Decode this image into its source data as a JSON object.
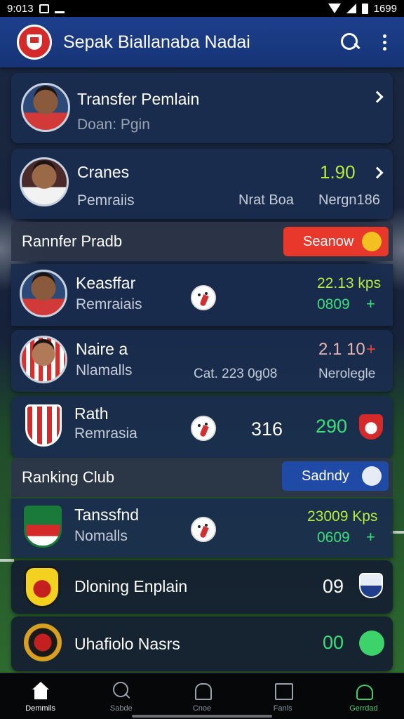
{
  "status_bar": {
    "time": "9:013",
    "clock_right": "1699"
  },
  "app_bar": {
    "title": "Sepak Biallanaba Nadai",
    "logo_icon": "club-crest-icon",
    "search_icon": "search-icon",
    "more_icon": "more-vert-icon"
  },
  "cards_top": [
    {
      "title": "Transfer Pemlain",
      "subtitle": "Doan: Pgin"
    },
    {
      "title": "Cranes",
      "subtitle": "Pemraiis",
      "meta": "Nrat Boa",
      "value": "1.90",
      "value2": "Nergn186"
    }
  ],
  "section_transfer": {
    "title": "Rannfer Pradb",
    "pill_label": "Seanow",
    "pill_color": "#e8382c"
  },
  "transfer_rows": [
    {
      "title": "Keasffar",
      "subtitle": "Remraiais",
      "value": "22.13 kps",
      "value2": "0809",
      "trend": "+"
    },
    {
      "title": "Naire a",
      "subtitle": "Nlamalls",
      "meta": "Cat. 223 0g08",
      "value": "2.1 10",
      "trend": "+",
      "value2": "Nerolegle"
    },
    {
      "title": "Rath",
      "subtitle": "Remrasia",
      "score": "316",
      "value": "290"
    }
  ],
  "section_ranking": {
    "title": "Ranking Club",
    "pill_label": "Sadndy",
    "pill_color": "#1f4aa6"
  },
  "ranking_rows": [
    {
      "title": "Tanssfnd",
      "subtitle": "Nomalls",
      "value": "23009 Kps",
      "value2": "0609",
      "trend": "+"
    },
    {
      "title": "Dloning Enplain",
      "score": "09"
    },
    {
      "title": "Uhafiolo Nasrs",
      "score": "00"
    }
  ],
  "bottom_nav": [
    {
      "label": "Demmils",
      "icon": "home-icon"
    },
    {
      "label": "Sabde",
      "icon": "search-icon"
    },
    {
      "label": "Cnoe",
      "icon": "bell-icon"
    },
    {
      "label": "Fanls",
      "icon": "box-icon"
    },
    {
      "label": "Gerrdad",
      "icon": "transfer-icon"
    }
  ],
  "colors": {
    "app_bar": "#1d3f8c",
    "positive": "#39e07a",
    "highlight": "#b6ec3a",
    "negative": "#e0453a"
  }
}
